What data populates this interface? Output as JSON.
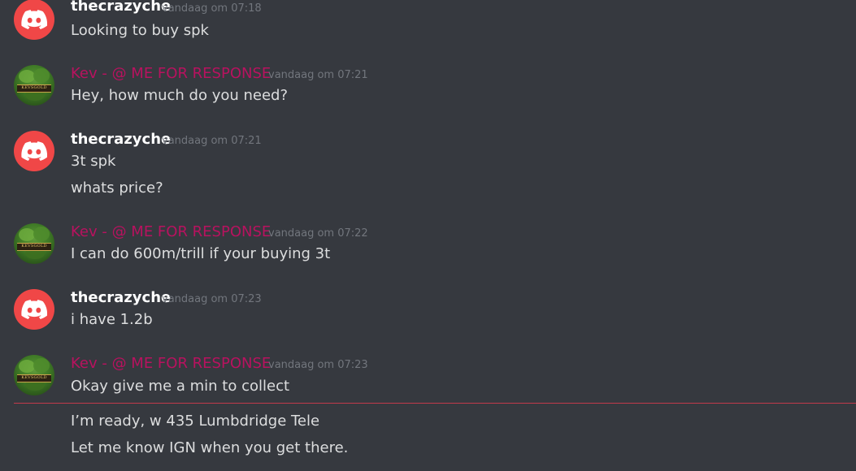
{
  "colors": {
    "background": "#36393f",
    "username_default": "#ffffff",
    "username_kev": "#b8125f",
    "message_text": "#dcddde",
    "timestamp": "#72767d",
    "new_messages_divider": "#c23b4b",
    "discord_avatar": "#f04747"
  },
  "messages": [
    {
      "author": "thecrazyche",
      "timestamp": "vandaag om 07:18",
      "lines": [
        "Looking to buy spk"
      ]
    },
    {
      "author": "Kev - @ ME FOR RESPONSE",
      "timestamp": "vandaag om 07:21",
      "lines": [
        "Hey, how much do you need?"
      ]
    },
    {
      "author": "thecrazyche",
      "timestamp": "vandaag om 07:21",
      "lines": [
        "3t spk",
        "whats price?"
      ]
    },
    {
      "author": "Kev - @ ME FOR RESPONSE",
      "timestamp": "vandaag om 07:22",
      "lines": [
        "I can do 600m/trill if your buying 3t"
      ]
    },
    {
      "author": "thecrazyche",
      "timestamp": "vandaag om 07:23",
      "lines": [
        "i have 1.2b"
      ]
    },
    {
      "author": "Kev - @ ME FOR RESPONSE",
      "timestamp": "vandaag om 07:23",
      "lines": [
        "Okay give me a min to collect"
      ]
    }
  ],
  "after_divider_lines": [
    "I’m ready, w 435 Lumbdridge Tele",
    "Let me know IGN when you get there."
  ],
  "kev_avatar_banner": "KEVSGOLD",
  "icons": {
    "discord_avatar_icon": "discord-logo-icon"
  }
}
